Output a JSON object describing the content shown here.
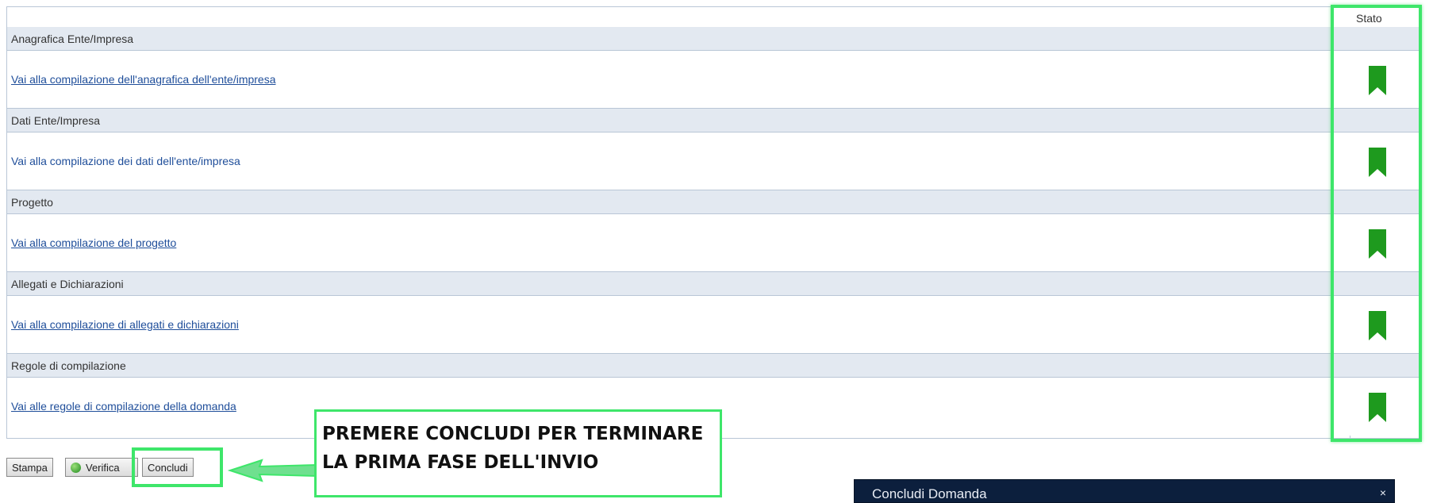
{
  "table": {
    "stato_header": "Stato",
    "sections": [
      {
        "title": "Anagrafica Ente/Impresa",
        "link": "Vai alla compilazione dell'anagrafica dell'ente/impresa",
        "status_icon": "bookmark-icon"
      },
      {
        "title": "Dati Ente/Impresa",
        "link": "Vai alla compilazione dei dati dell'ente/impresa",
        "status_icon": "bookmark-icon"
      },
      {
        "title": "Progetto",
        "link": "Vai alla compilazione del progetto",
        "status_icon": "bookmark-icon"
      },
      {
        "title": "Allegati e Dichiarazioni",
        "link": "Vai alla compilazione di allegati e dichiarazioni",
        "status_icon": "bookmark-icon"
      },
      {
        "title": "Regole di compilazione",
        "link": "Vai alle regole di compilazione della domanda",
        "status_icon": "bookmark-icon"
      }
    ],
    "status_color": "#1e9a1e"
  },
  "buttons": {
    "stampa": "Stampa",
    "verifica": "Verifica",
    "concludi": "Concludi"
  },
  "callout": {
    "text": "PREMERE CONCLUDI PER TERMINARE LA PRIMA FASE DELL'INVIO",
    "highlight_color": "#3ee66a"
  },
  "dialog": {
    "title": "Concludi Domanda",
    "close": "×"
  }
}
